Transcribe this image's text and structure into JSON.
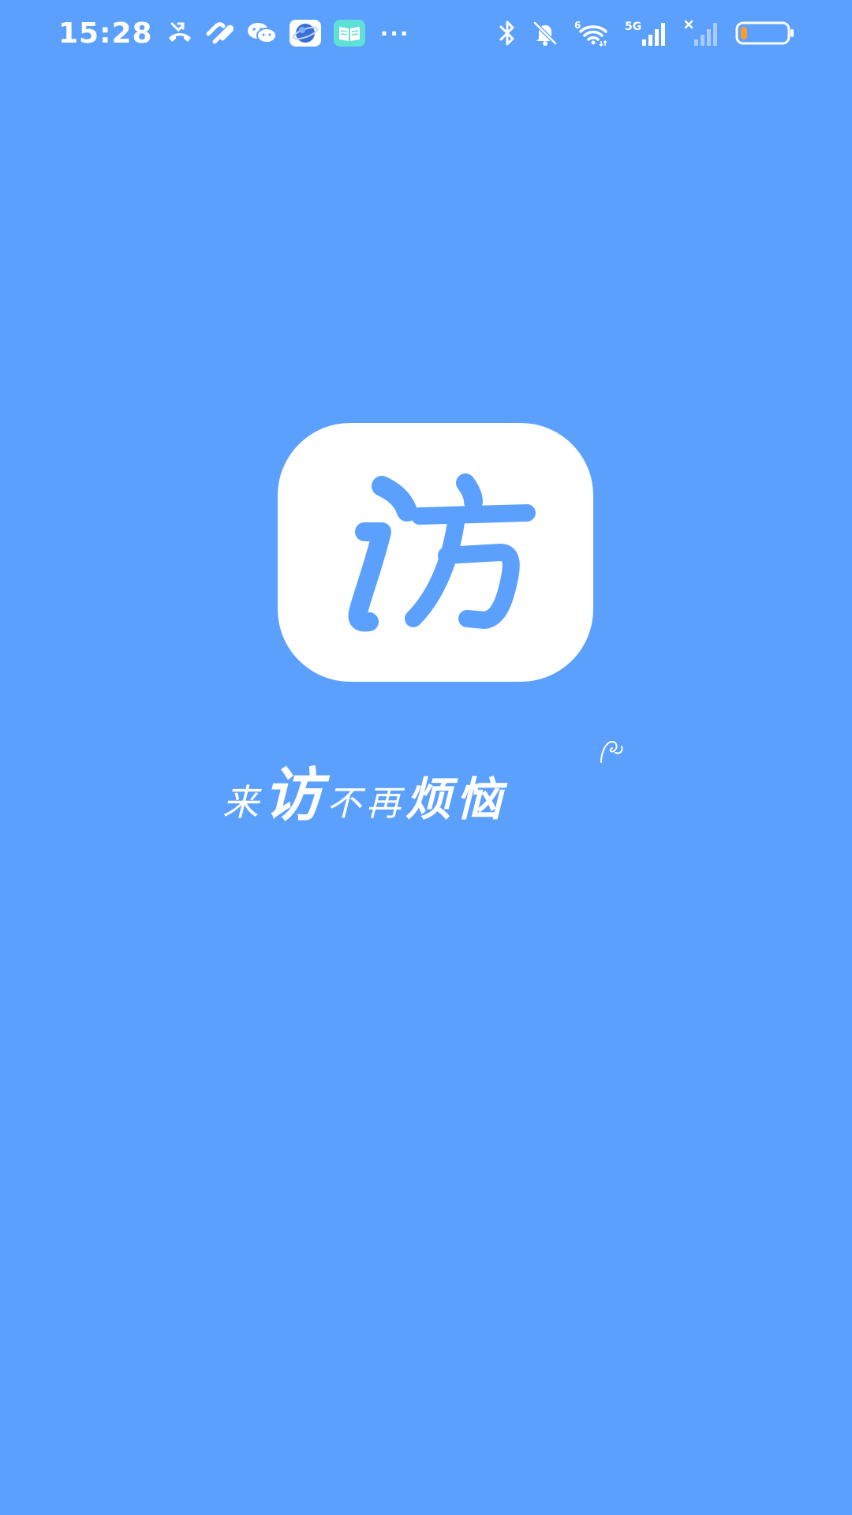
{
  "status_bar": {
    "time": "15:28",
    "more": "···",
    "icons_left": [
      "missed-call-icon",
      "link-icon",
      "wechat-icon",
      "browser-icon",
      "book-app-icon"
    ],
    "icons_right": [
      "bluetooth-icon",
      "mute-bell-icon",
      "wifi-icon",
      "signal-5g-icon",
      "signal-no-service-icon",
      "battery-low-icon"
    ],
    "wifi_label": "6",
    "network_label": "5G",
    "battery_level_percent": 15
  },
  "splash": {
    "logo_char": "访",
    "slogan_parts": [
      "来",
      "访",
      "不再",
      "烦恼"
    ]
  },
  "colors": {
    "background": "#5ca0fe",
    "logo_fg": "#5ca0fe",
    "logo_bg": "#ffffff",
    "battery_fill": "#ff9d2a"
  }
}
